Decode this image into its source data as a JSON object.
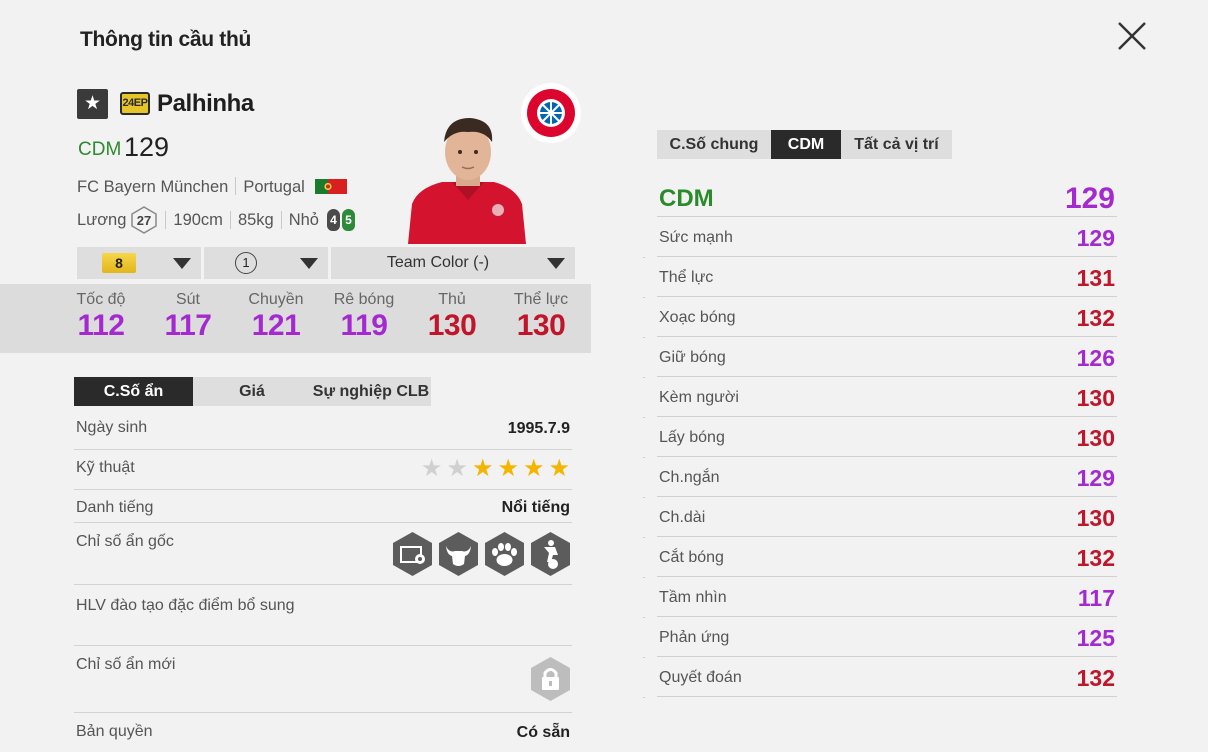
{
  "header": {
    "title": "Thông tin cầu thủ"
  },
  "player": {
    "season_badge": "24EP",
    "name": "Palhinha",
    "position": "CDM",
    "ovr": "129",
    "club": "FC Bayern München",
    "nation": "Portugal",
    "salary_label": "Lương",
    "salary": "27",
    "height": "190cm",
    "weight": "85kg",
    "body": "Nhỏ",
    "weak_foot": "4",
    "strong_foot": "5"
  },
  "selectors": {
    "level": "8",
    "count": "1",
    "team_color": "Team Color (-)"
  },
  "main_stats": [
    {
      "label": "Tốc độ",
      "value": "112",
      "color": "#a42ad0"
    },
    {
      "label": "Sút",
      "value": "117",
      "color": "#a42ad0"
    },
    {
      "label": "Chuyền",
      "value": "121",
      "color": "#a42ad0"
    },
    {
      "label": "Rê bóng",
      "value": "119",
      "color": "#a42ad0"
    },
    {
      "label": "Thủ",
      "value": "130",
      "color": "#c0162b"
    },
    {
      "label": "Thể lực",
      "value": "130",
      "color": "#c0162b"
    }
  ],
  "left_tabs": [
    "C.Số ẩn",
    "Giá",
    "Sự nghiệp CLB"
  ],
  "info": {
    "birth_label": "Ngày sinh",
    "birth": "1995.7.9",
    "skill_label": "Kỹ thuật",
    "skill_stars": 4,
    "reputation_label": "Danh tiếng",
    "reputation": "Nổi tiếng",
    "hidden_label": "Chỉ số ẩn gốc",
    "hidden_icons": [
      "goalkeeper-net-icon",
      "bull-icon",
      "paw-icon",
      "player-ball-icon"
    ],
    "coach_label": "HLV đào tạo đặc điểm bổ sung",
    "new_hidden_label": "Chỉ số ẩn mới",
    "rights_label": "Bản quyền",
    "rights": "Có sẵn"
  },
  "right_tabs": [
    "C.Số chung",
    "CDM",
    "Tất cả vị trí"
  ],
  "position_head": {
    "label": "CDM",
    "value": "129",
    "color": "#a42ad0"
  },
  "position_stats": [
    {
      "label": "Sức mạnh",
      "value": "129",
      "color": "#a42ad0"
    },
    {
      "label": "Thể lực",
      "value": "131",
      "color": "#c0162b"
    },
    {
      "label": "Xoạc bóng",
      "value": "132",
      "color": "#c0162b"
    },
    {
      "label": "Giữ bóng",
      "value": "126",
      "color": "#a42ad0"
    },
    {
      "label": "Kèm người",
      "value": "130",
      "color": "#c0162b"
    },
    {
      "label": "Lấy bóng",
      "value": "130",
      "color": "#c0162b"
    },
    {
      "label": "Ch.ngắn",
      "value": "129",
      "color": "#a42ad0"
    },
    {
      "label": "Ch.dài",
      "value": "130",
      "color": "#c0162b"
    },
    {
      "label": "Cắt bóng",
      "value": "132",
      "color": "#c0162b"
    },
    {
      "label": "Tầm nhìn",
      "value": "117",
      "color": "#a42ad0"
    },
    {
      "label": "Phản ứng",
      "value": "125",
      "color": "#a42ad0"
    },
    {
      "label": "Quyết đoán",
      "value": "132",
      "color": "#c0162b"
    }
  ]
}
